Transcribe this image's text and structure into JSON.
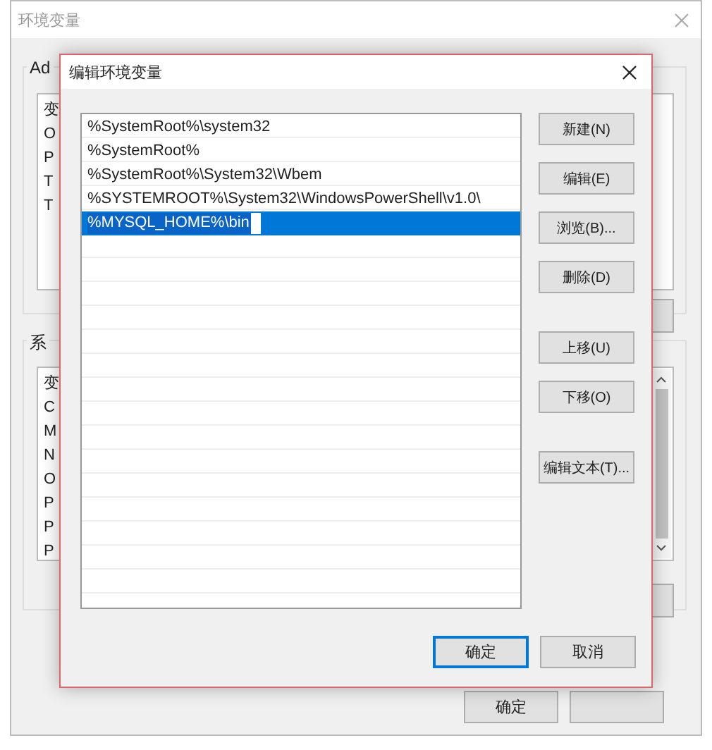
{
  "window": {
    "title": "环境变量"
  },
  "user_group": {
    "label": "Ad",
    "list": [
      "变",
      "O",
      "P",
      "T",
      "T"
    ]
  },
  "system_group": {
    "label": "系",
    "list": [
      "变",
      "C",
      "M",
      "N",
      "O",
      "P",
      "P",
      "P"
    ]
  },
  "buttons": [
    "确定"
  ],
  "dialog": {
    "title": "编辑环境变量",
    "entries": [
      {
        "text": "%SystemRoot%\\system32",
        "selected": false
      },
      {
        "text": "%SystemRoot%",
        "selected": false
      },
      {
        "text": "%SystemRoot%\\System32\\Wbem",
        "selected": false
      },
      {
        "text": "%SYSTEMROOT%\\System32\\WindowsPowerShell\\v1.0\\",
        "selected": false
      },
      {
        "text": "%MYSQL_HOME%\\bin",
        "selected": true
      }
    ],
    "side_button_groups": [
      [
        "新建(N)",
        "编辑(E)",
        "浏览(B)...",
        "删除(D)"
      ],
      [
        "上移(U)",
        "下移(O)"
      ],
      [
        "编辑文本(T)..."
      ]
    ],
    "footer_buttons": [
      {
        "label": "确定",
        "focused": true
      },
      {
        "label": "取消",
        "focused": false
      }
    ]
  }
}
